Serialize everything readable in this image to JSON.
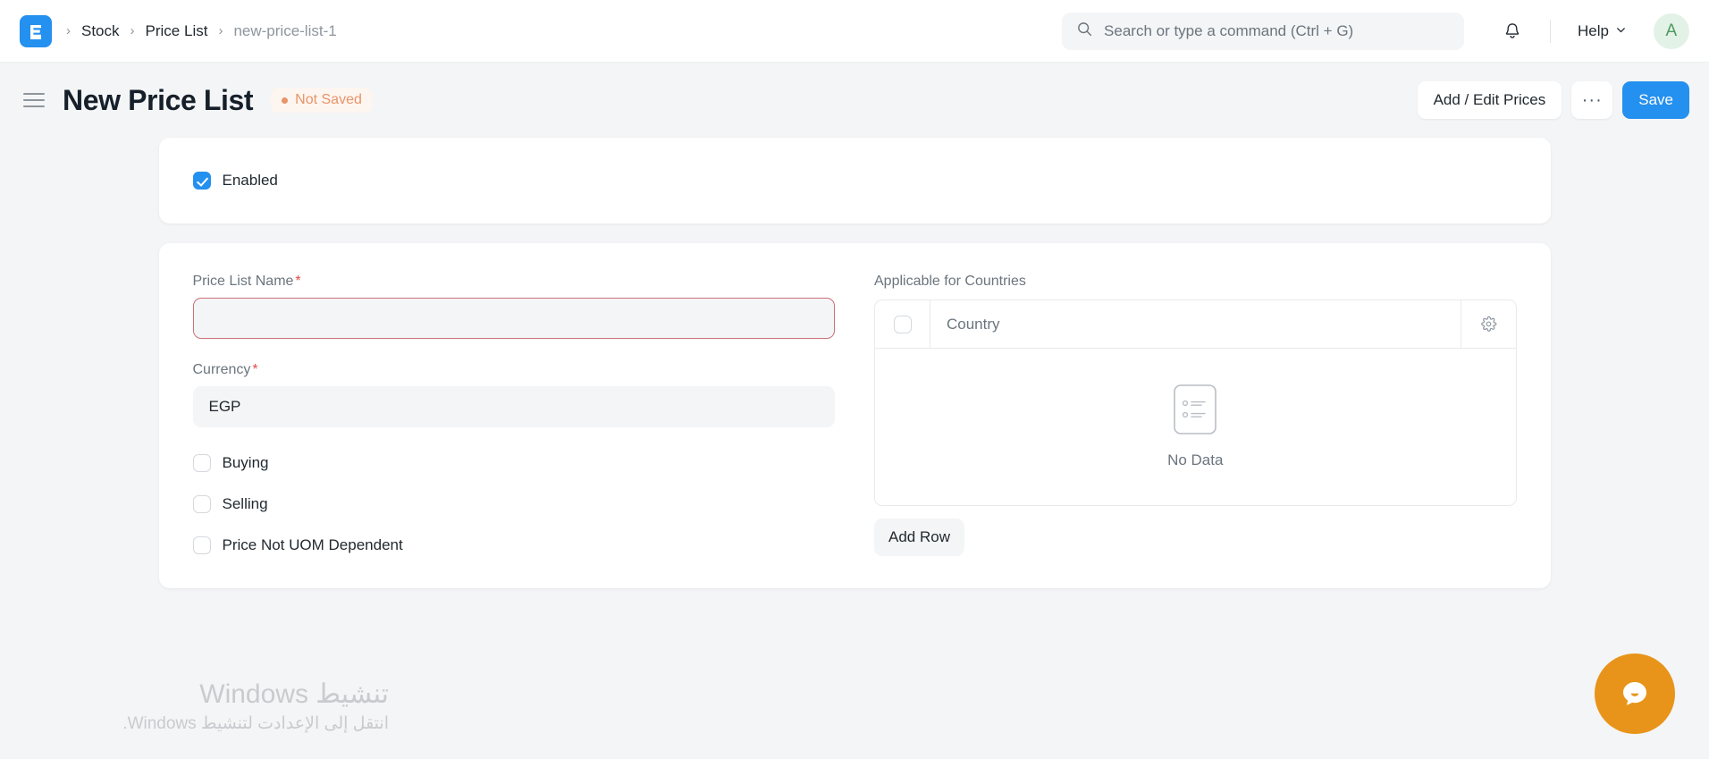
{
  "navbar": {
    "logo_icon": "erpnext-logo-icon",
    "breadcrumbs": [
      {
        "label": "Stock",
        "muted": false
      },
      {
        "label": "Price List",
        "muted": false
      },
      {
        "label": "new-price-list-1",
        "muted": true
      }
    ],
    "separator": "›",
    "search": {
      "icon": "search-icon",
      "placeholder": "Search or type a command (Ctrl + G)",
      "value": ""
    },
    "notifications_icon": "bell-icon",
    "help": {
      "label": "Help",
      "chevron_icon": "chevron-down-icon"
    },
    "avatar": {
      "initial": "A",
      "bg": "#e3f2e6",
      "fg": "#4e9a5f"
    }
  },
  "page_head": {
    "menu_icon": "hamburger-menu-icon",
    "title": "New Price List",
    "status": {
      "label": "Not Saved",
      "color": "#e8956a"
    },
    "actions": {
      "add_edit_prices": "Add / Edit Prices",
      "more": "···",
      "save": "Save"
    }
  },
  "form": {
    "enabled": {
      "label": "Enabled",
      "checked": true
    },
    "left_column": {
      "price_list_name": {
        "label": "Price List Name",
        "required": true,
        "required_mark": "*",
        "value": "",
        "placeholder": "",
        "invalid": true
      },
      "currency": {
        "label": "Currency",
        "required": true,
        "required_mark": "*",
        "value": "EGP"
      },
      "checkboxes": [
        {
          "label": "Buying",
          "checked": false
        },
        {
          "label": "Selling",
          "checked": false
        },
        {
          "label": "Price Not UOM Dependent",
          "checked": false
        }
      ]
    },
    "right_column": {
      "grid_label": "Applicable for Countries",
      "columns": [
        "Country"
      ],
      "rows": [],
      "select_all_checked": false,
      "settings_icon": "gear-icon",
      "empty": {
        "icon": "no-data-list-icon",
        "text": "No Data"
      },
      "add_row_label": "Add Row"
    }
  },
  "watermark": {
    "title": "تنشيط Windows",
    "subtitle": "انتقل إلى الإعدادت لتنشيط Windows."
  },
  "chat_widget": {
    "icon": "chat-bubble-icon",
    "color": "#e8941a"
  },
  "theme": {
    "primary": "#2490ef",
    "page_bg": "#f4f5f6",
    "card_bg": "#ffffff",
    "text": "#1f272e",
    "muted_text": "#6b757e",
    "danger": "#e24c4c"
  }
}
